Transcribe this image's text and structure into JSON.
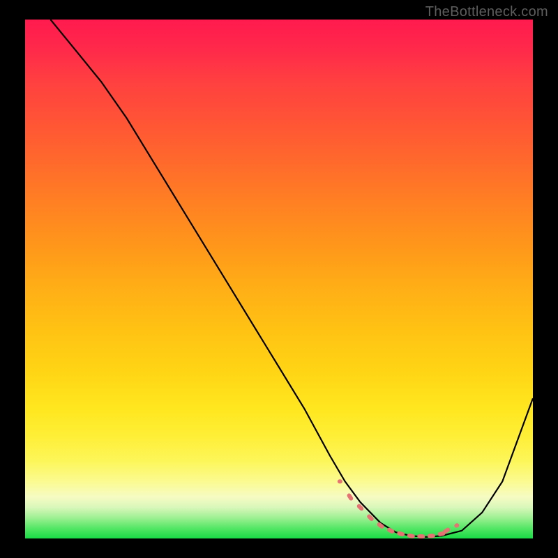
{
  "watermark": "TheBottleneck.com",
  "chart_data": {
    "type": "line",
    "title": "",
    "xlabel": "",
    "ylabel": "",
    "xlim": [
      0,
      100
    ],
    "ylim": [
      0,
      100
    ],
    "grid": false,
    "gradient": {
      "top_color": "#ff1a4e",
      "bottom_color": "#19db45",
      "meaning": "red=high bottleneck, green=low bottleneck"
    },
    "series": [
      {
        "name": "bottleneck-curve",
        "color": "#000000",
        "x": [
          5,
          10,
          15,
          20,
          25,
          30,
          35,
          40,
          45,
          50,
          55,
          60,
          63,
          66,
          70,
          73,
          76,
          79,
          82,
          86,
          90,
          94,
          100
        ],
        "y": [
          100,
          94,
          88,
          81,
          73,
          65,
          57,
          49,
          41,
          33,
          25,
          16,
          11,
          7,
          3,
          1.2,
          0.5,
          0.3,
          0.5,
          1.5,
          5,
          11,
          27
        ]
      },
      {
        "name": "highlight-range",
        "color": "#e57373",
        "type": "scatter",
        "note": "dashed/dotted marker segment near valley bottom",
        "x": [
          62,
          64,
          66,
          68,
          70,
          72,
          74,
          76,
          78,
          80,
          82,
          83,
          85
        ],
        "y": [
          11,
          8,
          6,
          4,
          2.5,
          1.5,
          0.9,
          0.5,
          0.4,
          0.5,
          0.9,
          1.5,
          2.5
        ]
      }
    ],
    "optimum_x": 79
  }
}
